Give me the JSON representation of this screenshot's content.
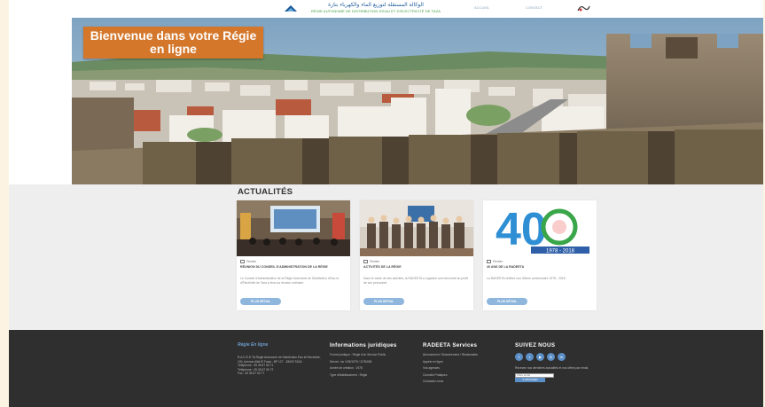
{
  "header": {
    "logo_text_ar": "الوكالة المستقلة لتوزيع الماء والكهرباء بتازة",
    "logo_text_fr": "RÉGIE AUTONOME DE DISTRIBUTION D'EAU ET D'ÉLECTRICITÉ DE TAZA",
    "nav": [
      {
        "label": "ACCUEIL"
      },
      {
        "label": "CONTACT"
      }
    ]
  },
  "hero": {
    "title": "Bienvenue dans votre Régie en ligne"
  },
  "news": {
    "heading": "ACTUALITÉS",
    "cards": [
      {
        "meta": "Février",
        "title": "Réunion du Conseil d'Administration de la Régie",
        "excerpt": "Le Conseil d'Administration de la Régie Autonome de Distribution d'Eau et d'Électricité de Taza a tenu sa réunion ordinaire.",
        "button": "PLUS DÉTAIL"
      },
      {
        "meta": "Février",
        "title": "Activités de la Régie",
        "excerpt": "Dans le cadre de ses activités, la RADEETA a organisé une rencontre au profit de son personnel.",
        "button": "PLUS DÉTAIL"
      },
      {
        "meta": "Février",
        "title": "40 ans de la RADEETA",
        "excerpt": "La RADEETA célèbre son 40ème anniversaire 1978 - 2018.",
        "button": "PLUS DÉTAIL",
        "logo_number": "40",
        "logo_years": "1978 - 2018"
      }
    ]
  },
  "footer": {
    "brand": "Régie En ligne",
    "address_text": "R.A.D.E.E.TA Régie Autonome de Distribution Eau et Electricité, 100, Avenue Allal El Fassi - BP 127 - 35000 TAZA",
    "phone_1": "Téléphone : 05 35 67 50 71",
    "phone_2": "Téléphone : 05 35 67 50 72",
    "fax": "Fax : 05 35 67 50 77",
    "col2_heading": "Informations juridiques",
    "col2_items": [
      "Forme juridique : Régie d'un Service Public",
      "Décret : du 1/05/1978 / 2/78/456",
      "Année de création : 1978",
      "Type d'établissement : Régie"
    ],
    "col3_heading": "RADEETA Services",
    "col3_items": [
      "Abonnement / Branchement / Réclamation",
      "Appels en ligne",
      "Vos agences",
      "Conseils Pratiques",
      "Contactez-nous"
    ],
    "col4_heading": "SUIVEZ NOUS",
    "social": [
      {
        "icon": "facebook-icon",
        "glyph": "f"
      },
      {
        "icon": "twitter-icon",
        "glyph": "t"
      },
      {
        "icon": "youtube-icon",
        "glyph": "▶"
      },
      {
        "icon": "instagram-icon",
        "glyph": "◎"
      },
      {
        "icon": "linkedin-icon",
        "glyph": "in"
      }
    ],
    "newsletter_text": "Recevez nos dernières actualités et nos offres par email.",
    "newsletter_placeholder": "Votre email",
    "newsletter_button": "S'ABONNER"
  },
  "colors": {
    "accent": "#d4772b",
    "footer_bg": "#2f2f2f",
    "link_blue": "#5b8fc7"
  }
}
